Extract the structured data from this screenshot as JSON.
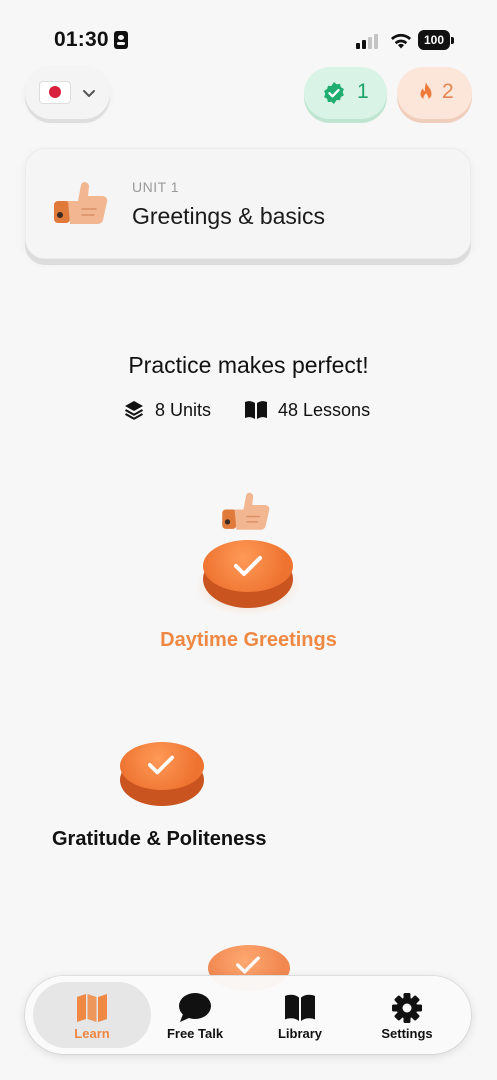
{
  "status_bar": {
    "time": "01:30",
    "battery": "100"
  },
  "top_bar": {
    "language_flag": "japan-flag-icon",
    "xp": {
      "count": "1",
      "icon": "verified-check-icon",
      "color": "#1ca46a"
    },
    "streak": {
      "count": "2",
      "icon": "flame-icon",
      "color": "#e28553"
    }
  },
  "unit": {
    "eyebrow": "UNIT 1",
    "title": "Greetings & basics",
    "icon": "thumbs-up-icon"
  },
  "intro": {
    "tagline": "Practice makes perfect!",
    "units": "8 Units",
    "lessons": "48 Lessons"
  },
  "lessons": [
    {
      "title": "Daytime Greetings",
      "status": "completed",
      "current": true
    },
    {
      "title": "Gratitude & Politeness",
      "status": "completed",
      "current": false
    },
    {
      "title": "",
      "status": "completed",
      "current": false
    }
  ],
  "tab_bar": {
    "tabs": [
      {
        "label": "Learn",
        "icon": "map-icon",
        "active": true
      },
      {
        "label": "Free Talk",
        "icon": "speech-bubble-icon",
        "active": false
      },
      {
        "label": "Library",
        "icon": "book-icon",
        "active": false
      },
      {
        "label": "Settings",
        "icon": "gear-icon",
        "active": false
      }
    ]
  },
  "colors": {
    "accent": "#ef8843",
    "lesson_disc": "#ee7330",
    "background": "#f7f7f7"
  }
}
